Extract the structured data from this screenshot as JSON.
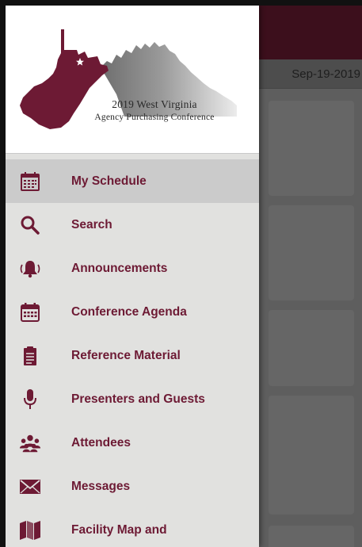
{
  "header": {
    "logo_line1": "2019 West Virginia",
    "logo_line2": "Agency Purchasing Conference"
  },
  "background": {
    "date": "Sep-19-2019"
  },
  "menu": {
    "items": [
      {
        "label": "My Schedule",
        "icon": "schedule-icon",
        "active": true
      },
      {
        "label": "Search",
        "icon": "search-icon"
      },
      {
        "label": "Announcements",
        "icon": "bell-icon"
      },
      {
        "label": "Conference Agenda",
        "icon": "calendar-icon"
      },
      {
        "label": "Reference Material",
        "icon": "clipboard-icon"
      },
      {
        "label": "Presenters and Guests",
        "icon": "microphone-icon"
      },
      {
        "label": "Attendees",
        "icon": "people-icon"
      },
      {
        "label": "Messages",
        "icon": "envelope-icon"
      },
      {
        "label": "Facility Map and",
        "icon": "map-icon"
      }
    ]
  },
  "colors": {
    "brand": "#6d1a34",
    "icon": "#6d1a34",
    "drawer_bg": "#e1e1df",
    "active_item_bg": "#cbcbcb",
    "app_bar": "#3c0f1c"
  }
}
